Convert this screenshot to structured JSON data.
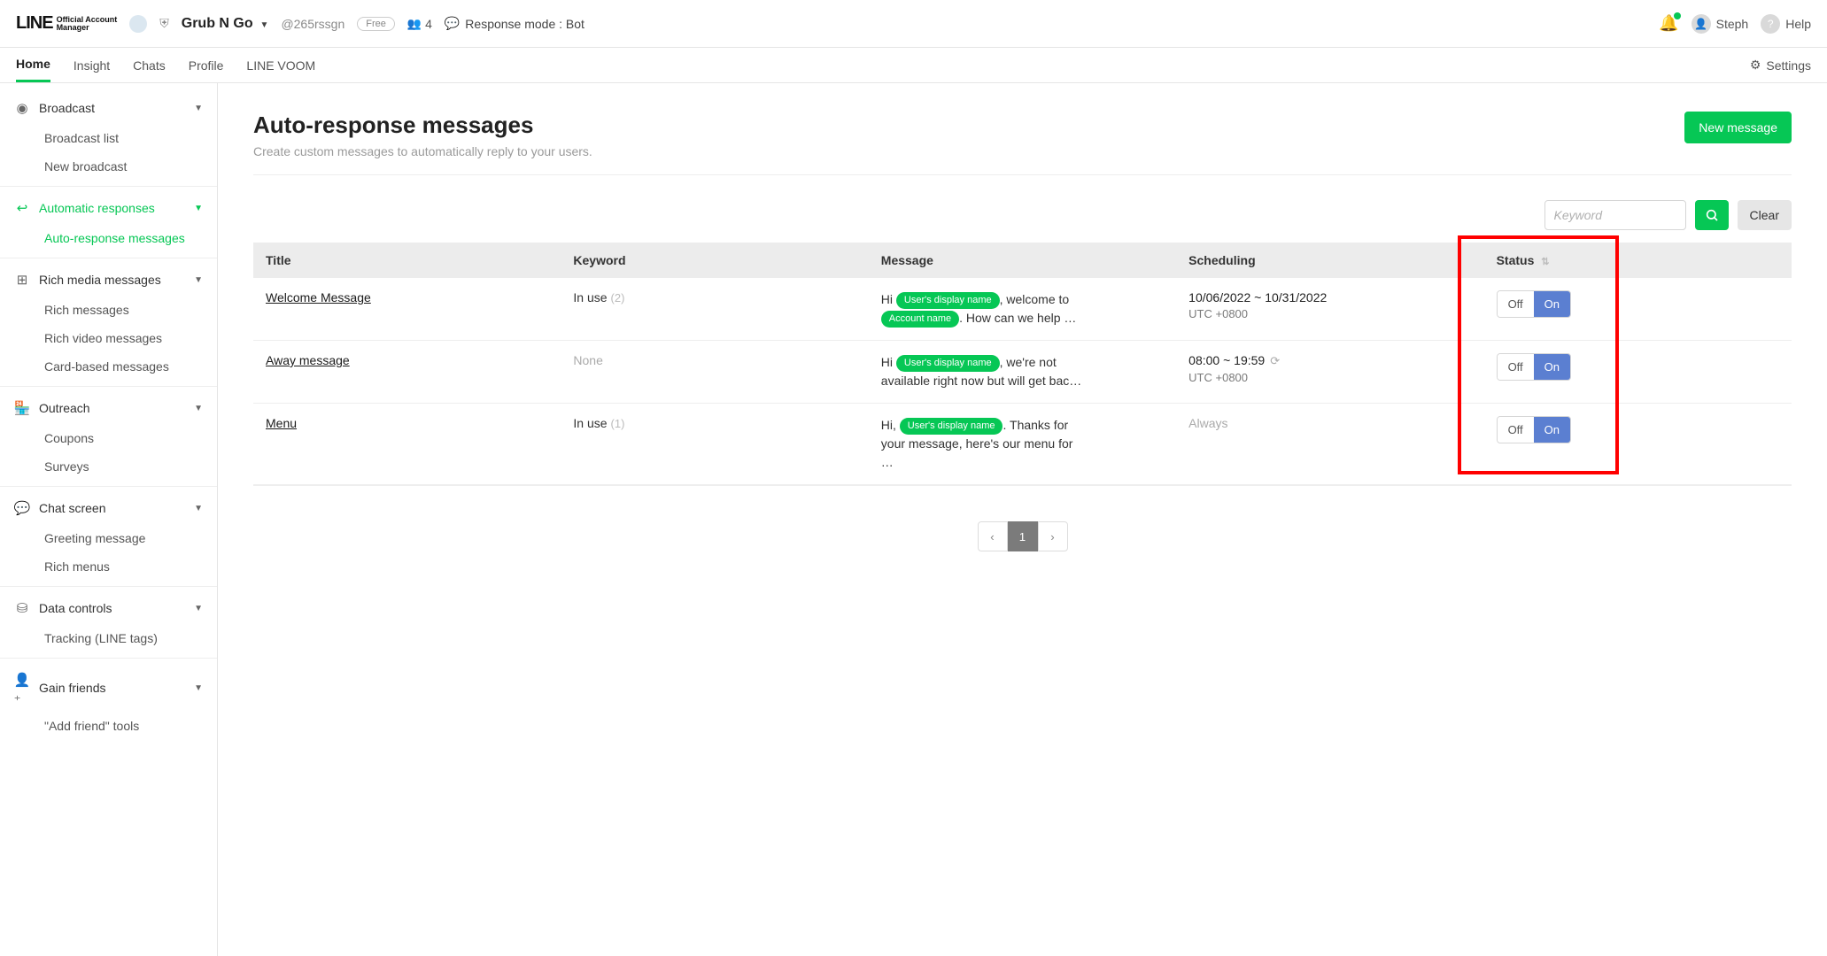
{
  "header": {
    "logo_main": "LINE",
    "logo_sub_top": "Official Account",
    "logo_sub_bottom": "Manager",
    "account_name": "Grub N Go",
    "account_handle": "@265rssgn",
    "plan_badge": "Free",
    "friends_count": "4",
    "response_mode": "Response mode : Bot",
    "user_name": "Steph",
    "help_label": "Help"
  },
  "nav": {
    "tabs": [
      "Home",
      "Insight",
      "Chats",
      "Profile",
      "LINE VOOM"
    ],
    "active_index": 0,
    "settings_label": "Settings"
  },
  "sidebar": {
    "groups": [
      {
        "label": "Broadcast",
        "active": false,
        "items": [
          "Broadcast list",
          "New broadcast"
        ]
      },
      {
        "label": "Automatic responses",
        "active": true,
        "items": [
          "Auto-response messages"
        ],
        "active_item": 0
      },
      {
        "label": "Rich media messages",
        "active": false,
        "items": [
          "Rich messages",
          "Rich video messages",
          "Card-based messages"
        ]
      },
      {
        "label": "Outreach",
        "active": false,
        "items": [
          "Coupons",
          "Surveys"
        ]
      },
      {
        "label": "Chat screen",
        "active": false,
        "items": [
          "Greeting message",
          "Rich menus"
        ]
      },
      {
        "label": "Data controls",
        "active": false,
        "items": [
          "Tracking (LINE tags)"
        ]
      },
      {
        "label": "Gain friends",
        "active": false,
        "items": [
          "\"Add friend\" tools"
        ]
      }
    ]
  },
  "page": {
    "title": "Auto-response messages",
    "subtitle": "Create custom messages to automatically reply to your users.",
    "new_btn": "New message",
    "search_placeholder": "Keyword",
    "clear_btn": "Clear"
  },
  "table": {
    "columns": {
      "title": "Title",
      "keyword": "Keyword",
      "message": "Message",
      "scheduling": "Scheduling",
      "status": "Status"
    },
    "chip_user": "User's display name",
    "chip_account": "Account name",
    "toggle": {
      "off": "Off",
      "on": "On"
    },
    "rows": [
      {
        "title": "Welcome Message",
        "keyword_status": "In use",
        "keyword_count": "(2)",
        "msg_pre1": "Hi ",
        "msg_post1": ", welcome to ",
        "msg_post2": ". How can we help …",
        "sched_main": "10/06/2022 ~ 10/31/2022",
        "sched_sub": "UTC +0800",
        "repeat": false
      },
      {
        "title": "Away message",
        "keyword_status": "None",
        "keyword_count": "",
        "msg_pre1": "Hi ",
        "msg_post1": ", we're not available right now but will get bac…",
        "sched_main": "08:00 ~ 19:59",
        "sched_sub": "UTC +0800",
        "repeat": true
      },
      {
        "title": "Menu",
        "keyword_status": "In use",
        "keyword_count": "(1)",
        "msg_pre1": "Hi, ",
        "msg_post1": ". Thanks for your message, here's our menu for …",
        "sched_main": "Always",
        "sched_sub": "",
        "repeat": false,
        "sched_always": true
      }
    ]
  },
  "pager": {
    "current": "1"
  }
}
